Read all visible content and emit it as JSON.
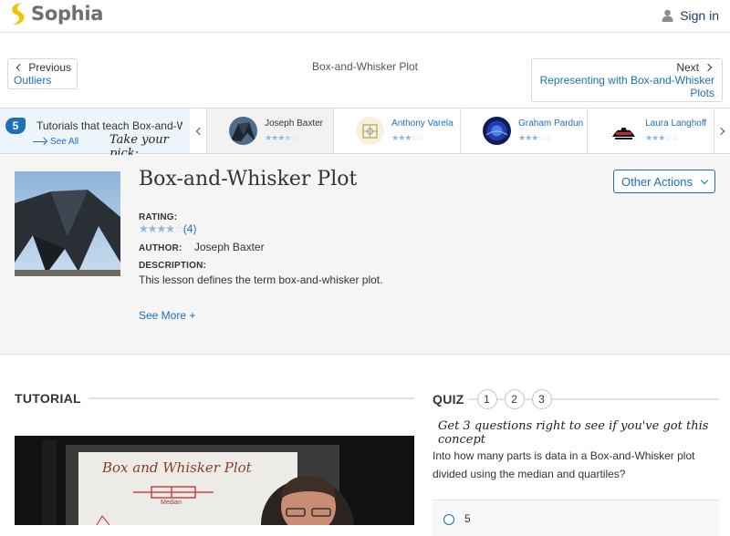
{
  "brand": {
    "name": "Sophia",
    "accent": "#1d6fb8",
    "logo_color": "#f2c200"
  },
  "header": {
    "signin_label": "Sign in",
    "user_icon": "user-icon"
  },
  "nav": {
    "prev_label": "Previous",
    "prev_link": "Outliers",
    "current_title": "Box-and-Whisker Plot",
    "next_label": "Next",
    "next_link": "Representing with Box-and-Whisker Plots"
  },
  "tutorials_strip": {
    "count": "5",
    "text": "Tutorials that teach Box-and-Whisker Plot",
    "see_all": "See All",
    "pick_label": "Take your pick:",
    "teachers": [
      {
        "name": "Joseph Baxter",
        "rating": 3.5,
        "active": true
      },
      {
        "name": "Anthony Varela",
        "rating": 3,
        "active": false
      },
      {
        "name": "Graham Pardun",
        "rating": 3,
        "active": false
      },
      {
        "name": "Laura Langhoff",
        "rating": 3,
        "active": false
      }
    ]
  },
  "lesson": {
    "title": "Box-and-Whisker Plot",
    "other_actions": "Other Actions",
    "rating_label": "RATING:",
    "rating_value": 4,
    "rating_count": "(4)",
    "author_label": "AUTHOR:",
    "author": "Joseph Baxter",
    "description_label": "DESCRIPTION:",
    "description": "This lesson defines the term box-and-whisker plot.",
    "see_more": "See More +"
  },
  "tutorial": {
    "heading": "TUTORIAL",
    "video_board_text": "Box and Whisker Plot",
    "video_board_label": "Median"
  },
  "quiz": {
    "heading": "QUIZ",
    "numbers": [
      "1",
      "2",
      "3"
    ],
    "tagline": "Get 3 questions right to see if you've got this concept",
    "question": "Into how many parts is data in a Box-and-Whisker plot divided using the median and quartiles?",
    "answers": [
      "5"
    ]
  }
}
